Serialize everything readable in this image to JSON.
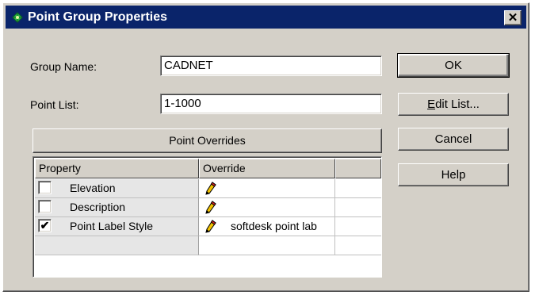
{
  "dialog": {
    "title": "Point Group Properties",
    "close_glyph": "✕"
  },
  "form": {
    "group_name_label": "Group Name:",
    "group_name_value": "CADNET",
    "point_list_label": "Point List:",
    "point_list_value": "1-1000"
  },
  "buttons": {
    "ok": "OK",
    "edit_list": "Edit List...",
    "cancel": "Cancel",
    "help": "Help"
  },
  "overrides": {
    "header": "Point Overrides",
    "columns": [
      "Property",
      "Override",
      ""
    ],
    "rows": [
      {
        "property": "Elevation",
        "checked": false,
        "check_glyph": "",
        "icon": "pencil-icon",
        "override": ""
      },
      {
        "property": "Description",
        "checked": false,
        "check_glyph": "",
        "icon": "pencil-icon",
        "override": ""
      },
      {
        "property": "Point Label Style",
        "checked": true,
        "check_glyph": "✔",
        "icon": "pencil-icon",
        "override": "softdesk point lab"
      }
    ]
  },
  "colors": {
    "title_bar": "#0a246a",
    "face": "#d4d0c8",
    "property_cell": "#e6e6e6"
  }
}
